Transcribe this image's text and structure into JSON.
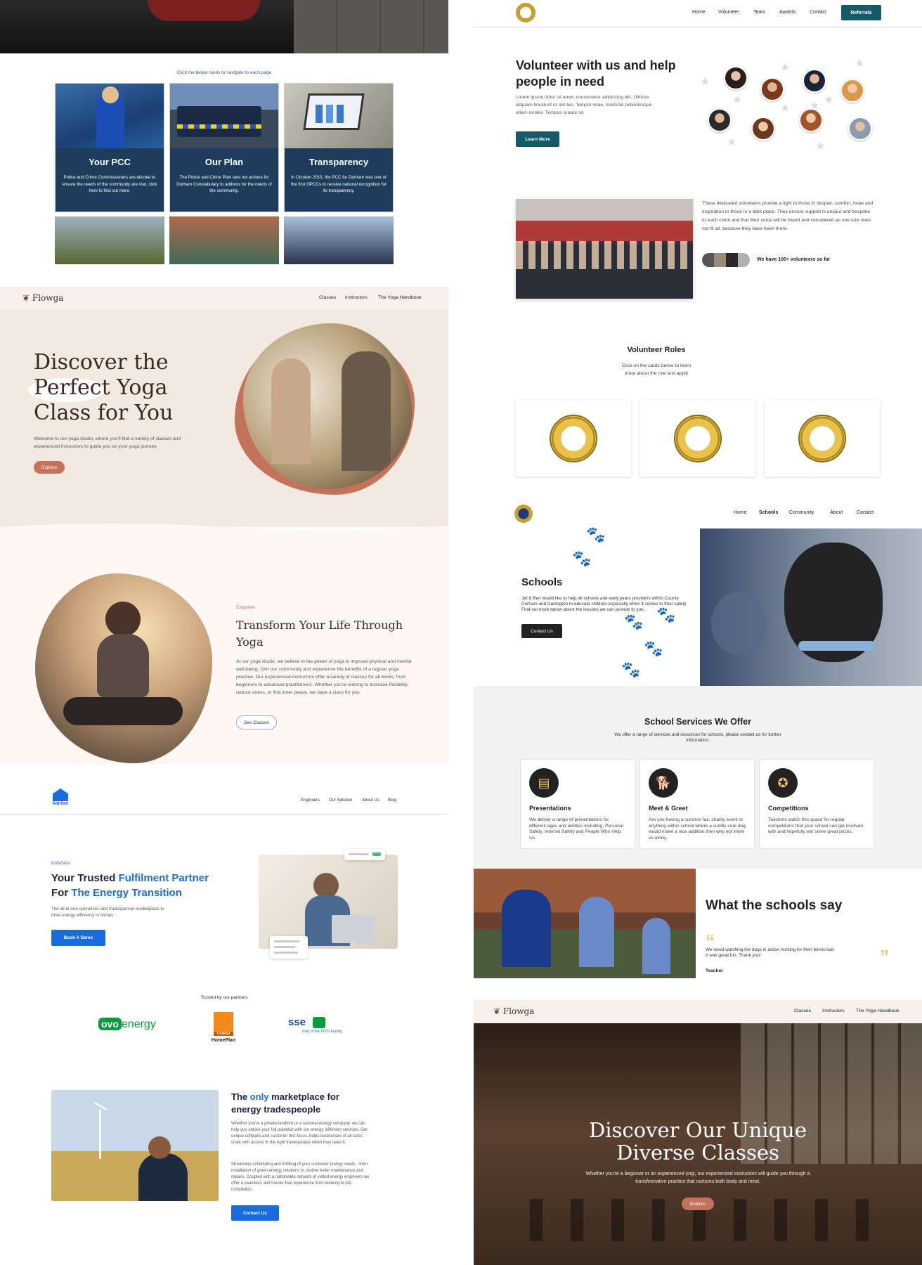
{
  "pcc": {
    "nav_hint": "Click the below cards to navigate to each page",
    "cards": [
      {
        "title": "Your PCC",
        "text": "Police and Crime Commissioners are elected to ensure the needs of the community are met, click here to find out more."
      },
      {
        "title": "Our Plan",
        "text": "The Police and Crime Plan sets out actions for Durham Constabulary to address for the needs of the community."
      },
      {
        "title": "Transparency",
        "text": "In October 2015, the PCC for Durham was one of the first OPCCs to receive national recognition for its transparency."
      }
    ]
  },
  "flowga1": {
    "brand": "Flowga",
    "nav": [
      "Classes",
      "Instructors",
      "The Yoga Handbook"
    ],
    "hero_title_l1": "Discover the",
    "hero_title_l2": "Perfect Yoga",
    "hero_title_l3": "Class for You",
    "hero_text": "Welcome to our yoga studio, where you'll find a variety of classes and experienced instructors to guide you on your yoga journey.",
    "hero_button": "Explore",
    "section_eyebrow": "Empower",
    "section_title": "Transform Your Life Through Yoga",
    "section_text": "At our yoga studio, we believe in the power of yoga to improve physical and mental well-being. Join our community and experience the benefits of a regular yoga practice. Our experienced instructors offer a variety of classes for all levels, from beginners to advanced practitioners. Whether you're looking to increase flexibility, reduce stress, or find inner peace, we have a class for you.",
    "section_button": "See Classes"
  },
  "kantan": {
    "logo": "kantan",
    "nav": [
      "Engineers",
      "Our Solution",
      "About Us",
      "Blog"
    ],
    "eyebrow": "KANTAN",
    "title_a": "Your Trusted ",
    "title_b": "Fulfilment Partner",
    "title_c": "For ",
    "title_d": "The Energy Transition",
    "text": "The all-in-one operations and tradesperson marketplace to drive energy efficiency in homes.",
    "button": "Book A Demo",
    "partners_label": "Trusted by our partners",
    "partner_ovo": "energy",
    "partner_corgi": "CORGI",
    "partner_corgi_sub": "HomePlan",
    "partner_sse": "sse",
    "partner_sse_sub": "Part of the OVO Family",
    "section_title_a": "The ",
    "section_title_b": "only",
    "section_title_c": " marketplace for energy tradespeople",
    "section_p1": "Whether you're a private landlord or a national energy company, we can help you unlock your full potential with our energy fulfilment services. Our unique software and customer first focus, helps businesses of all sizes scale with access to the right tradespeople when they need it.",
    "section_p2": "Streamline scheduling and fulfilling of your customer energy needs - from installation of green energy solutions to routine boiler maintenance and repairs. Coupled with a nationwide network of vetted energy engineers we offer a seamless and hassle-free experience from booking to job completion.",
    "section_button": "Contact Us"
  },
  "volunteer": {
    "nav": [
      "Home",
      "Volunteer",
      "Team",
      "Awards",
      "Contact"
    ],
    "nav_button": "Referrals",
    "hero_title": "Volunteer with us and help people in need",
    "hero_text": "Lorem ipsum dolor sit amet, consectetur adipiscing elit. Ultrices aliquam tincidunt ut nisl leo. Tempor vitae, molestie pellentesque etiam ornare. Tempus ornare sit.",
    "hero_button": "Learn More",
    "about_text": "These dedicated volunteers provide a light to those in despair, comfort, hope and inspiration to those in a dark place. They ensure support is unique and bespoke to each client and that their voice will be heard and considered as one size does not fit all, because they have been there.",
    "count_text": "We have 100+ volunteers so far",
    "roles_title": "Volunteer Roles",
    "roles_text": "Click on the cards below to learn more about the role and apply"
  },
  "schools": {
    "nav": [
      "Home",
      "Schools",
      "Community",
      "About",
      "Contact"
    ],
    "title": "Schools",
    "text": "Jet & Ben would like to help all schools and early years providers within County Durham and Darlington to educate children especially when it comes to their safety. Find out more below about the lessons we can provide to you.",
    "button": "Contact Us",
    "services_title": "School Services We Offer",
    "services_text": "We offer a range of services and resources for schools, please contact us for further information.",
    "services": [
      {
        "title": "Presentations",
        "text": "We deliver a range of presentations for different ages and abilities including; Personal Safety, Internet Safety and People Who Help Us."
      },
      {
        "title": "Meet & Greet",
        "text": "Are you having a summer fair, charity event or anything within school where a cuddly cute dog would make a nice addition then why not invite us along."
      },
      {
        "title": "Competitions",
        "text": "Teachers watch this space for regular competitions that your school can get involved with and hopefully win some great prizes."
      }
    ],
    "say_title": "What the schools say",
    "quote": "We loved watching the dogs in action hunting for their tennis ball. It was great fun. Thank you!",
    "quote_author": "Teacher"
  },
  "flowga2": {
    "brand": "Flowga",
    "nav": [
      "Classes",
      "Instructors",
      "The Yoga Handbook"
    ],
    "title_l1": "Discover Our Unique",
    "title_l2": "Diverse Classes",
    "text": "Whether you're a beginner or an experienced yogi, our experienced instructors will guide you through a transformative practice that nurtures both body and mind.",
    "button": "Explore"
  }
}
